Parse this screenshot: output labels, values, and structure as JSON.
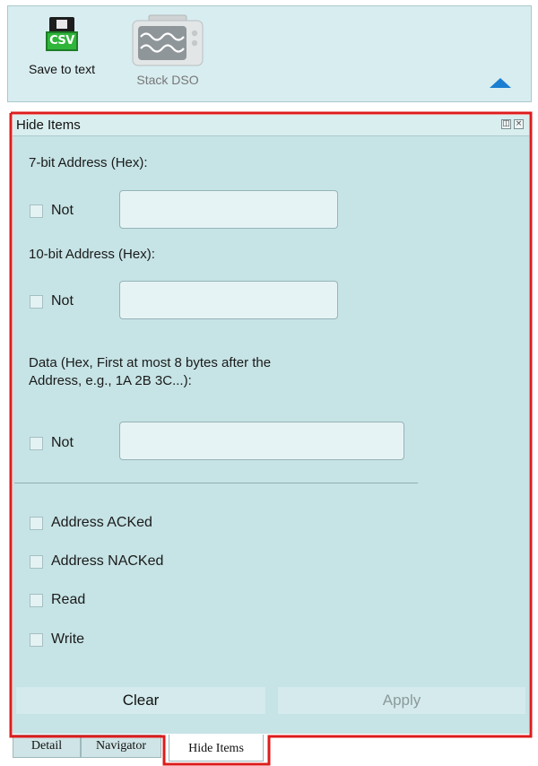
{
  "toolbar": {
    "save_label": "Save to text",
    "save_icon_text": "CSV",
    "dso_label": "Stack DSO"
  },
  "panel": {
    "title": "Hide Items",
    "seven_bit_label": "7-bit Address (Hex):",
    "ten_bit_label": "10-bit Address (Hex):",
    "data_label_line1": "Data (Hex, First at most 8 bytes after the",
    "data_label_line2": "Address, e.g., 1A 2B 3C...):",
    "not_label": "Not",
    "seven_bit_value": "",
    "ten_bit_value": "",
    "data_value": "",
    "filters": [
      {
        "label": "Address ACKed",
        "checked": false
      },
      {
        "label": "Address NACKed",
        "checked": false
      },
      {
        "label": "Read",
        "checked": false
      },
      {
        "label": "Write",
        "checked": false
      }
    ],
    "clear_label": "Clear",
    "apply_label": "Apply"
  },
  "tabs": [
    {
      "label": "Detail",
      "active": false
    },
    {
      "label": "Navigator",
      "active": false
    },
    {
      "label": "Hide Items",
      "active": true
    }
  ],
  "colors": {
    "highlight": "#dd1c1c",
    "panel_bg": "#c6e3e5",
    "toolbar_bg": "#d8edf0",
    "accent_arrow": "#1a7fd1"
  },
  "icons": {
    "save": "csv-floppy-icon",
    "dso": "oscilloscope-icon",
    "collapse": "triangle-up-icon",
    "restore": "restore-window-icon",
    "close": "close-icon"
  }
}
